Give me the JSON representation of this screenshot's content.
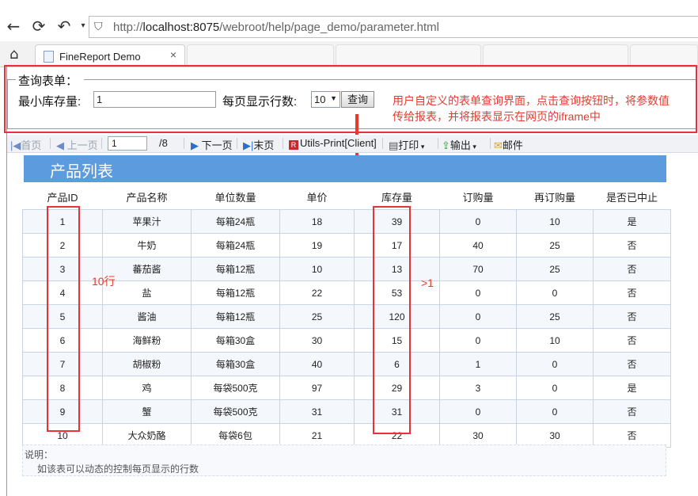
{
  "browser": {
    "url_prefix": "http://",
    "url_host": "localhost:8075",
    "url_path": "/webroot/help/page_demo/parameter.html",
    "tab_title": "FineReport Demo",
    "tab_close": "×"
  },
  "form": {
    "legend": "查询表单：",
    "min_stock_label": "最小库存量:",
    "min_stock_value": "1",
    "rows_label": "每页显示行数:",
    "rows_value": "10",
    "query_button": "查询"
  },
  "annotations": {
    "note": "用户自定义的表单查询界面，点击查询按钮时，将参数值传给报表，并将报表显示在网页的iframe中",
    "rows_note": "10行",
    "stock_note": ">1"
  },
  "toolbar": {
    "first": "首页",
    "prev": "上一页",
    "page_input": "1",
    "page_total": "/8",
    "next": "下一页",
    "last": "末页",
    "utils_print": "Utils-Print[Client]",
    "print": "打印",
    "export": "输出",
    "mail": "邮件"
  },
  "report": {
    "title": "产品列表",
    "columns": [
      "产品ID",
      "产品名称",
      "单位数量",
      "单价",
      "库存量",
      "订购量",
      "再订购量",
      "是否已中止"
    ],
    "rows": [
      [
        "1",
        "苹果汁",
        "每箱24瓶",
        "18",
        "39",
        "0",
        "10",
        "是"
      ],
      [
        "2",
        "牛奶",
        "每箱24瓶",
        "19",
        "17",
        "40",
        "25",
        "否"
      ],
      [
        "3",
        "蕃茄酱",
        "每箱12瓶",
        "10",
        "13",
        "70",
        "25",
        "否"
      ],
      [
        "4",
        "盐",
        "每箱12瓶",
        "22",
        "53",
        "0",
        "0",
        "否"
      ],
      [
        "5",
        "酱油",
        "每箱12瓶",
        "25",
        "120",
        "0",
        "25",
        "否"
      ],
      [
        "6",
        "海鲜粉",
        "每箱30盒",
        "30",
        "15",
        "0",
        "10",
        "否"
      ],
      [
        "7",
        "胡椒粉",
        "每箱30盒",
        "40",
        "6",
        "1",
        "0",
        "否"
      ],
      [
        "8",
        "鸡",
        "每袋500克",
        "97",
        "29",
        "3",
        "0",
        "是"
      ],
      [
        "9",
        "蟹",
        "每袋500克",
        "31",
        "31",
        "0",
        "0",
        "否"
      ],
      [
        "10",
        "大众奶酪",
        "每袋6包",
        "21",
        "22",
        "30",
        "30",
        "否"
      ]
    ]
  },
  "description": {
    "label": "说明：",
    "text": "如该表可以动态的控制每页显示的行数"
  }
}
